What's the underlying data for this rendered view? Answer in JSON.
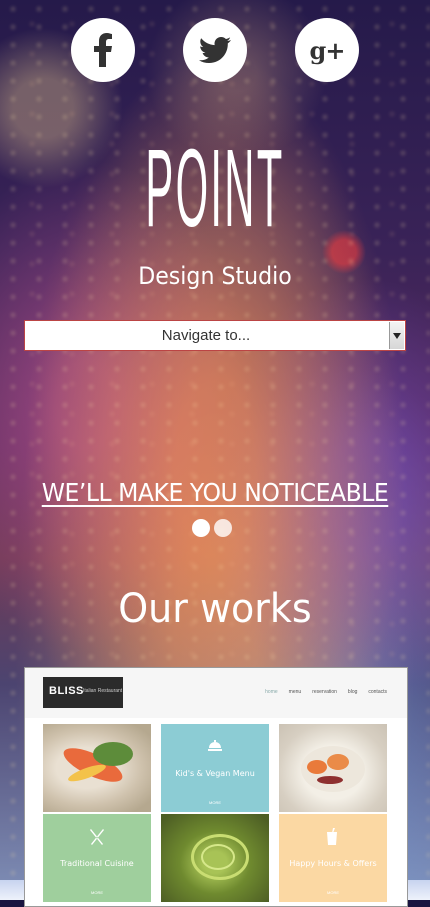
{
  "social": {
    "facebook_icon": "facebook-icon",
    "twitter_icon": "twitter-icon",
    "googleplus_icon": "google-plus-icon",
    "googleplus_text": "g+"
  },
  "header": {
    "logo": "POINT",
    "tagline": "Design Studio"
  },
  "navigation": {
    "select_label": "Navigate to..."
  },
  "slider": {
    "headline": "WE’LL MAKE YOU NOTICEABLE",
    "active_slide": 1,
    "slide_count": 2
  },
  "works": {
    "title": "Our works",
    "preview": {
      "brand": "BLISS",
      "brand_sub": "Italian Restaurant",
      "menu": [
        "home",
        "menu",
        "reservation",
        "blog",
        "contacts"
      ],
      "tiles": [
        {
          "title": "",
          "more": ""
        },
        {
          "title": "Kid's & Vegan Menu",
          "more": "MORE"
        },
        {
          "title": "",
          "more": ""
        },
        {
          "title": "Traditional Cuisine",
          "more": "MORE"
        },
        {
          "title": "",
          "more": ""
        },
        {
          "title": "Happy Hours & Offers",
          "more": "MORE"
        }
      ]
    }
  },
  "colors": {
    "white": "#ffffff",
    "select_border": "#bb4444"
  }
}
